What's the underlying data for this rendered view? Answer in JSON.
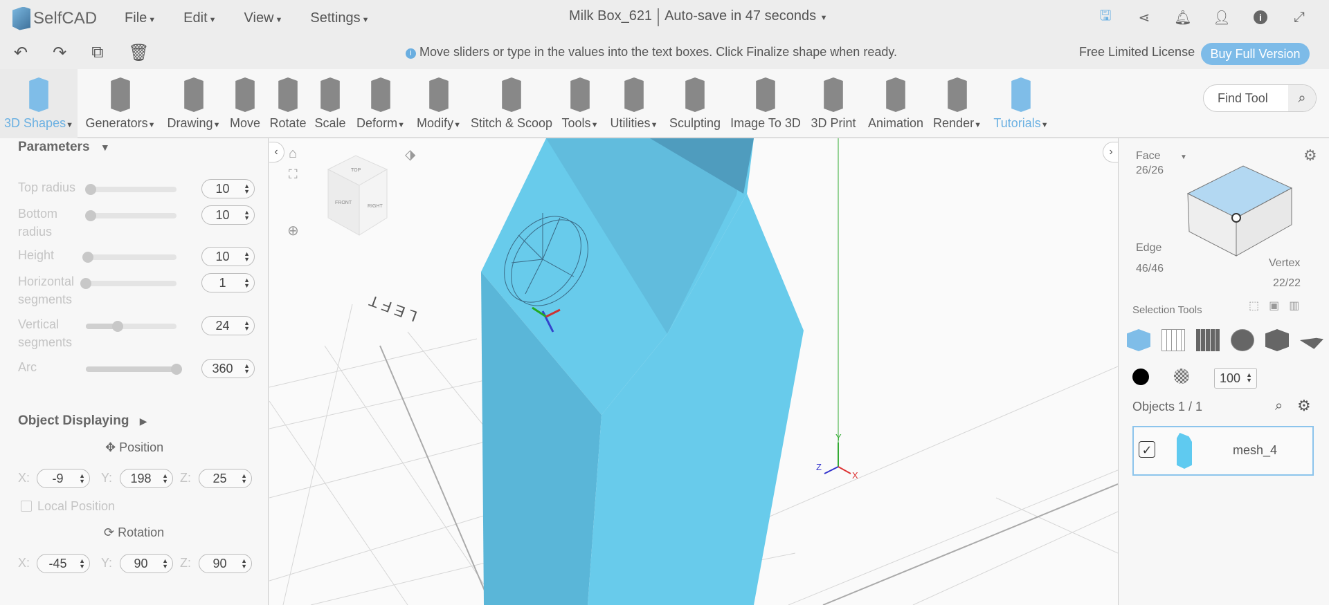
{
  "app": {
    "name": "SelfCAD",
    "menus": [
      "File",
      "Edit",
      "View",
      "Settings"
    ],
    "document_title": "Milk Box_621",
    "autosave": "Auto-save in 47 seconds"
  },
  "header_icons": [
    "save-icon",
    "share-icon",
    "bell-icon",
    "user-icon",
    "info-icon",
    "fullscreen-icon"
  ],
  "bar2": {
    "hint": "Move sliders or type in the values into the text boxes. Click Finalize shape when ready.",
    "license": "Free Limited License",
    "buy": "Buy Full Version"
  },
  "toolbar": {
    "items": [
      {
        "label": "3D Shapes",
        "dropdown": true
      },
      {
        "label": "Generators",
        "dropdown": true
      },
      {
        "label": "Drawing",
        "dropdown": true
      },
      {
        "label": "Move"
      },
      {
        "label": "Rotate"
      },
      {
        "label": "Scale"
      },
      {
        "label": "Deform",
        "dropdown": true
      },
      {
        "label": "Modify",
        "dropdown": true
      },
      {
        "label": "Stitch & Scoop"
      },
      {
        "label": "Tools",
        "dropdown": true
      },
      {
        "label": "Utilities",
        "dropdown": true
      },
      {
        "label": "Sculpting"
      },
      {
        "label": "Image To 3D"
      },
      {
        "label": "3D Print"
      },
      {
        "label": "Animation"
      },
      {
        "label": "Render",
        "dropdown": true
      },
      {
        "label": "Tutorials",
        "dropdown": true
      }
    ],
    "find_placeholder": "Find Tool"
  },
  "parameters": {
    "title": "Parameters",
    "rows": [
      {
        "label": "Top radius",
        "value": "10",
        "fraction": 0.05
      },
      {
        "label": "Bottom radius",
        "value": "10",
        "fraction": 0.05
      },
      {
        "label": "Height",
        "value": "10",
        "fraction": 0.02
      },
      {
        "label": "Horizontal segments",
        "value": "1",
        "fraction": 0.0
      },
      {
        "label": "Vertical segments",
        "value": "24",
        "fraction": 0.35
      },
      {
        "label": "Arc",
        "value": "360",
        "fraction": 1.0
      }
    ]
  },
  "object_displaying": {
    "title": "Object Displaying",
    "position_label": "Position",
    "position": {
      "x": "-9",
      "y": "198",
      "z": "25"
    },
    "local_position": "Local Position",
    "rotation_label": "Rotation",
    "rotation": {
      "x": "-45",
      "y": "90",
      "z": "90"
    },
    "axis_labels": {
      "x": "X:",
      "y": "Y:",
      "z": "Z:"
    }
  },
  "viewport": {
    "view_cube_faces": [
      "TOP",
      "RIGHT",
      "FRONT"
    ],
    "floor_label": "LEFT",
    "axes": {
      "x": "X",
      "y": "Y",
      "z": "Z"
    },
    "mesh_color": "#68cbeb"
  },
  "right": {
    "face_label": "Face",
    "face_count": "26/26",
    "edge_label": "Edge",
    "edge_count": "46/46",
    "vertex_label": "Vertex",
    "vertex_count": "22/22",
    "selection_tools": "Selection Tools",
    "opacity": "100",
    "objects_label": "Objects 1 / 1",
    "object_name": "mesh_4"
  }
}
